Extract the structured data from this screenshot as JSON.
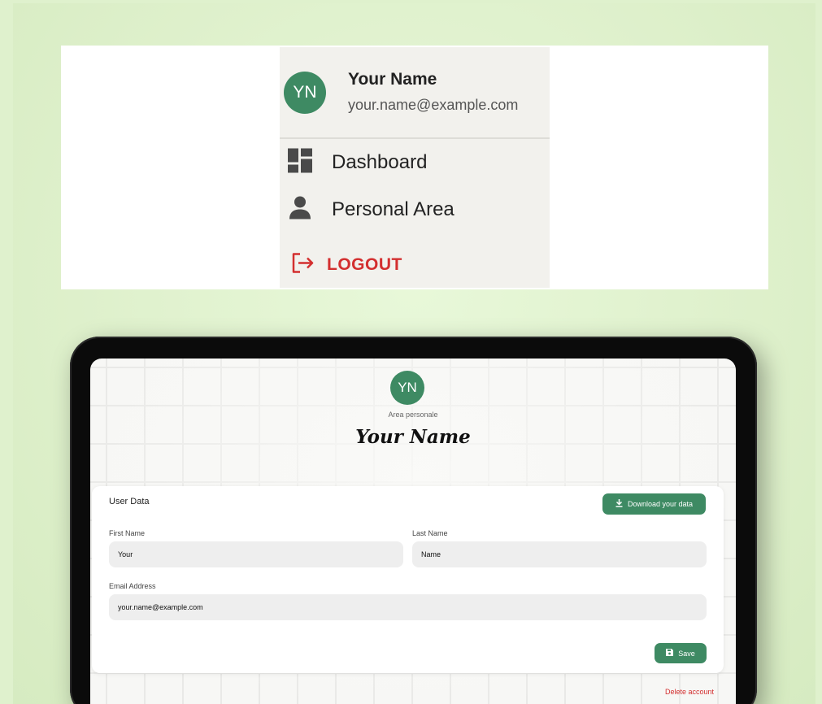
{
  "drawer": {
    "initials": "YN",
    "name": "Your Name",
    "email": "your.name@example.com",
    "items": [
      {
        "label": "Dashboard",
        "icon": "dashboard-icon"
      },
      {
        "label": "Personal Area",
        "icon": "person-icon"
      }
    ],
    "logout_label": "LOGOUT",
    "logout_icon": "logout-icon"
  },
  "profile": {
    "initials": "YN",
    "area_label": "Area personale",
    "name": "Your Name"
  },
  "user_data": {
    "title": "User Data",
    "download_label": "Download your data",
    "first_name_label": "First Name",
    "first_name_value": "Your",
    "last_name_label": "Last Name",
    "last_name_value": "Name",
    "email_label": "Email Address",
    "email_value": "your.name@example.com",
    "save_label": "Save"
  },
  "delete_label": "Delete account",
  "colors": {
    "accent": "#3e8a63",
    "danger": "#d32f2f",
    "background": "#dff1cd"
  }
}
